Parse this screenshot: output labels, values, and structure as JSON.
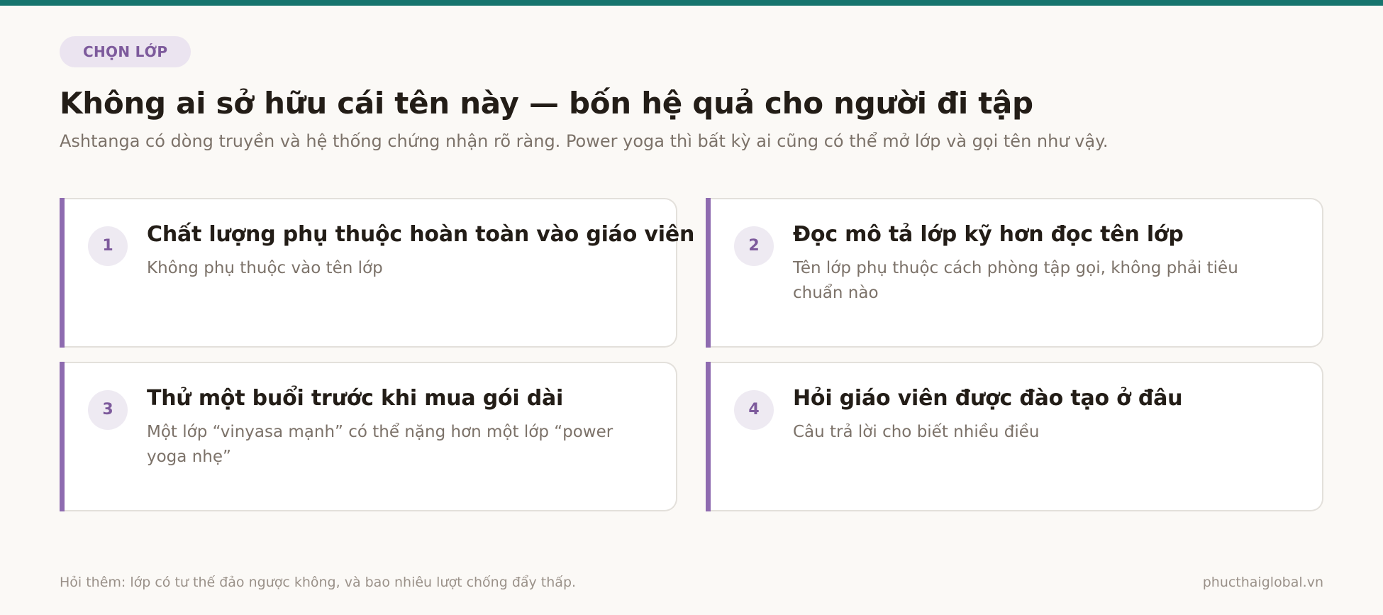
{
  "badge": "CHỌN LỚP",
  "title": "Không ai sở hữu cái tên này — bốn hệ quả cho người đi tập",
  "subtitle": "Ashtanga có dòng truyền và hệ thống chứng nhận rõ ràng. Power yoga thì bất kỳ ai cũng có thể mở lớp và gọi tên như vậy.",
  "cards": [
    {
      "number": "1",
      "title": "Chất lượng phụ thuộc hoàn toàn vào giáo viên",
      "desc": "Không phụ thuộc vào tên lớp"
    },
    {
      "number": "2",
      "title": "Đọc mô tả lớp kỹ hơn đọc tên lớp",
      "desc": "Tên lớp phụ thuộc cách phòng tập gọi, không phải tiêu chuẩn nào"
    },
    {
      "number": "3",
      "title": "Thử một buổi trước khi mua gói dài",
      "desc": "Một lớp “vinyasa mạnh” có thể nặng hơn một lớp “power yoga nhẹ”"
    },
    {
      "number": "4",
      "title": "Hỏi giáo viên được đào tạo ở đâu",
      "desc": "Câu trả lời cho biết nhiều điều"
    }
  ],
  "footer": {
    "note": "Hỏi thêm: lớp có tư thế đảo ngược không, và bao nhiêu lượt chống đẩy thấp.",
    "site": "phucthaiglobal.vn"
  },
  "colors": {
    "top_bar": "#17756e",
    "accent": "#8e6bb0",
    "background": "#fbf9f6"
  }
}
